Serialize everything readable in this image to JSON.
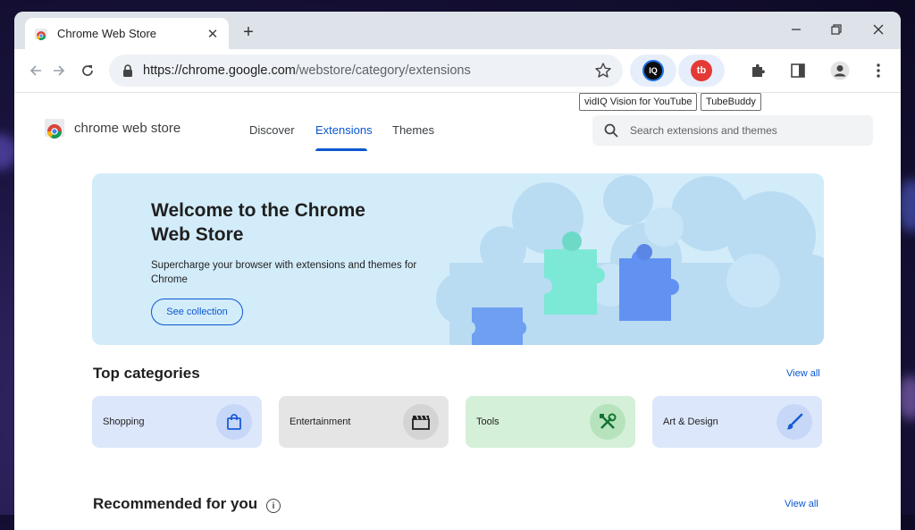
{
  "tab": {
    "title": "Chrome Web Store",
    "close": "✕",
    "new_tab": "+"
  },
  "window_controls": {
    "minimize": "—",
    "restore": "❐",
    "close": "✕"
  },
  "omnibox": {
    "url_host": "https://chrome.google.com",
    "url_path": "/webstore/category/extensions"
  },
  "extensions": [
    {
      "name": "vidIQ Vision for YouTube",
      "icon": "vidiq-icon",
      "color": "#1a73e8",
      "glyph": "IQ"
    },
    {
      "name": "TubeBuddy",
      "icon": "tubebuddy-icon",
      "color": "#e53935",
      "glyph": "tb"
    }
  ],
  "header": {
    "logo_text": "chrome web store",
    "nav": [
      {
        "label": "Discover",
        "active": false
      },
      {
        "label": "Extensions",
        "active": true
      },
      {
        "label": "Themes",
        "active": false
      }
    ],
    "search_placeholder": "Search extensions and themes"
  },
  "hero": {
    "title": "Welcome to the Chrome Web Store",
    "subtitle": "Supercharge your browser with extensions and themes for Chrome",
    "button": "See collection"
  },
  "top_categories": {
    "title": "Top categories",
    "view_all": "View all",
    "items": [
      {
        "label": "Shopping",
        "icon": "shopping-bag-icon",
        "bg": "#dde7fb",
        "icon_bg": "#c7d7f7",
        "icon_color": "#1a5bd6"
      },
      {
        "label": "Entertainment",
        "icon": "clapperboard-icon",
        "bg": "#e5e5e5",
        "icon_bg": "#d4d4d4",
        "icon_color": "#1f1f1f"
      },
      {
        "label": "Tools",
        "icon": "wrench-screwdriver-icon",
        "bg": "#d5f0d8",
        "icon_bg": "#b6e3bc",
        "icon_color": "#137333"
      },
      {
        "label": "Art & Design",
        "icon": "paintbrush-icon",
        "bg": "#dde7fb",
        "icon_bg": "#c7d7f7",
        "icon_color": "#1a5bd6"
      }
    ]
  },
  "recommended": {
    "title": "Recommended for you",
    "view_all": "View all"
  },
  "colors": {
    "accent": "#0b57d0",
    "hero_bg": "#d3ecfa"
  }
}
